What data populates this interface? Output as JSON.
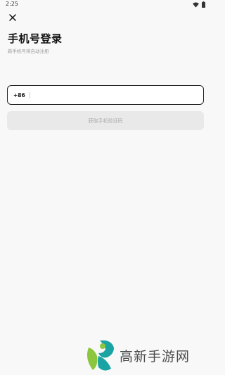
{
  "status_bar": {
    "time": "2:25",
    "icons": [
      "wifi-icon",
      "battery-icon"
    ]
  },
  "header": {
    "close_icon": "close-icon",
    "title": "手机号登录",
    "subtitle": "新手机号将自动注册"
  },
  "phone_form": {
    "country_code": "+86",
    "phone_value": "",
    "phone_placeholder": ""
  },
  "actions": {
    "get_code_label": "获取手机验证码",
    "get_code_disabled": true
  },
  "watermark": {
    "text": "高新手游网"
  },
  "colors": {
    "background": "#f8f8f8",
    "input_border": "#222222",
    "button_disabled_bg": "#e9e9e9",
    "button_disabled_text": "#aaaaaa",
    "logo_green": "#8cc63f",
    "logo_teal": "#1aa3a3"
  }
}
